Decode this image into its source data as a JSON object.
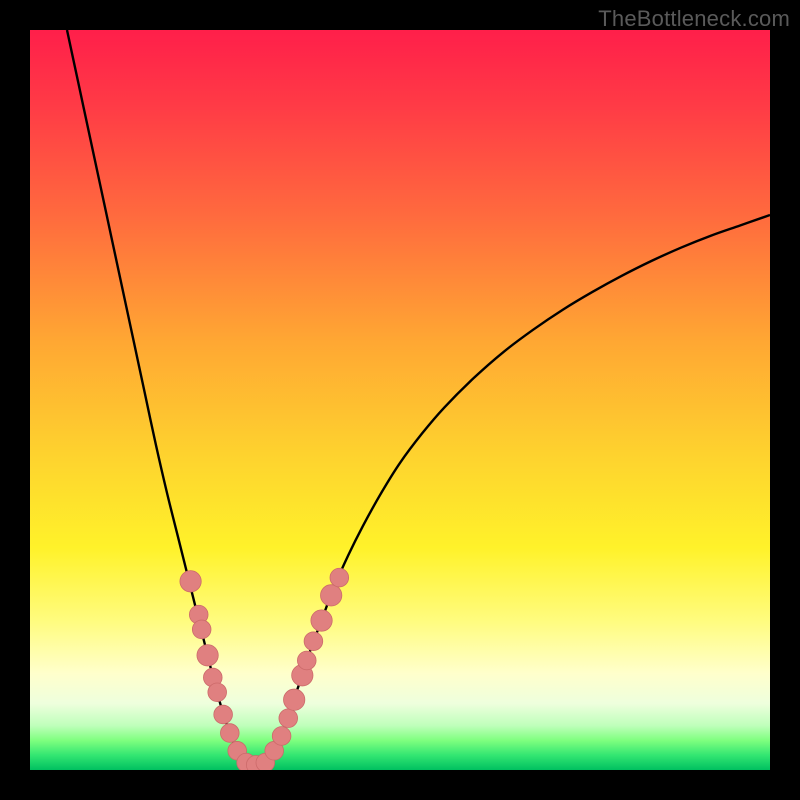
{
  "watermark": "TheBottleneck.com",
  "colors": {
    "curve": "#000000",
    "marker_fill": "#e08080",
    "marker_stroke": "#cc6a6a",
    "frame": "#000000"
  },
  "chart_data": {
    "type": "line",
    "title": "",
    "xlabel": "",
    "ylabel": "",
    "xlim": [
      0,
      100
    ],
    "ylim": [
      0,
      100
    ],
    "grid": false,
    "legend": false,
    "curve": {
      "points": [
        {
          "x": 5.0,
          "y": 100.0
        },
        {
          "x": 6.5,
          "y": 93.0
        },
        {
          "x": 8.0,
          "y": 86.0
        },
        {
          "x": 9.5,
          "y": 79.0
        },
        {
          "x": 11.0,
          "y": 72.0
        },
        {
          "x": 12.5,
          "y": 65.0
        },
        {
          "x": 14.0,
          "y": 58.0
        },
        {
          "x": 15.5,
          "y": 51.0
        },
        {
          "x": 17.0,
          "y": 44.0
        },
        {
          "x": 18.5,
          "y": 37.5
        },
        {
          "x": 20.0,
          "y": 31.5
        },
        {
          "x": 21.0,
          "y": 27.5
        },
        {
          "x": 22.0,
          "y": 23.5
        },
        {
          "x": 23.0,
          "y": 19.5
        },
        {
          "x": 24.0,
          "y": 15.5
        },
        {
          "x": 25.0,
          "y": 11.5
        },
        {
          "x": 26.0,
          "y": 8.0
        },
        {
          "x": 27.0,
          "y": 5.0
        },
        {
          "x": 28.0,
          "y": 2.6
        },
        {
          "x": 29.0,
          "y": 1.2
        },
        {
          "x": 30.0,
          "y": 0.7
        },
        {
          "x": 31.0,
          "y": 0.7
        },
        {
          "x": 32.0,
          "y": 1.2
        },
        {
          "x": 33.0,
          "y": 2.6
        },
        {
          "x": 34.0,
          "y": 4.6
        },
        {
          "x": 35.0,
          "y": 7.5
        },
        {
          "x": 36.0,
          "y": 10.5
        },
        {
          "x": 37.0,
          "y": 13.5
        },
        {
          "x": 38.0,
          "y": 16.5
        },
        {
          "x": 39.5,
          "y": 20.5
        },
        {
          "x": 41.0,
          "y": 24.5
        },
        {
          "x": 43.0,
          "y": 29.0
        },
        {
          "x": 45.0,
          "y": 33.0
        },
        {
          "x": 47.5,
          "y": 37.5
        },
        {
          "x": 50.0,
          "y": 41.5
        },
        {
          "x": 53.0,
          "y": 45.5
        },
        {
          "x": 56.0,
          "y": 49.0
        },
        {
          "x": 60.0,
          "y": 53.0
        },
        {
          "x": 64.0,
          "y": 56.5
        },
        {
          "x": 68.0,
          "y": 59.5
        },
        {
          "x": 72.0,
          "y": 62.2
        },
        {
          "x": 76.0,
          "y": 64.6
        },
        {
          "x": 80.0,
          "y": 66.8
        },
        {
          "x": 84.0,
          "y": 68.8
        },
        {
          "x": 88.0,
          "y": 70.6
        },
        {
          "x": 92.0,
          "y": 72.2
        },
        {
          "x": 96.0,
          "y": 73.6
        },
        {
          "x": 100.0,
          "y": 75.0
        }
      ]
    },
    "markers": [
      {
        "x": 21.7,
        "y": 25.5,
        "r": 1.6
      },
      {
        "x": 22.8,
        "y": 21.0,
        "r": 1.4
      },
      {
        "x": 23.2,
        "y": 19.0,
        "r": 1.4
      },
      {
        "x": 24.0,
        "y": 15.5,
        "r": 1.6
      },
      {
        "x": 24.7,
        "y": 12.5,
        "r": 1.4
      },
      {
        "x": 25.3,
        "y": 10.5,
        "r": 1.4
      },
      {
        "x": 26.1,
        "y": 7.5,
        "r": 1.4
      },
      {
        "x": 27.0,
        "y": 5.0,
        "r": 1.4
      },
      {
        "x": 28.0,
        "y": 2.6,
        "r": 1.4
      },
      {
        "x": 29.2,
        "y": 1.0,
        "r": 1.4
      },
      {
        "x": 30.5,
        "y": 0.7,
        "r": 1.4
      },
      {
        "x": 31.8,
        "y": 1.0,
        "r": 1.4
      },
      {
        "x": 33.0,
        "y": 2.6,
        "r": 1.4
      },
      {
        "x": 34.0,
        "y": 4.6,
        "r": 1.4
      },
      {
        "x": 34.9,
        "y": 7.0,
        "r": 1.4
      },
      {
        "x": 35.7,
        "y": 9.5,
        "r": 1.6
      },
      {
        "x": 36.8,
        "y": 12.8,
        "r": 1.6
      },
      {
        "x": 37.4,
        "y": 14.8,
        "r": 1.4
      },
      {
        "x": 38.3,
        "y": 17.4,
        "r": 1.4
      },
      {
        "x": 39.4,
        "y": 20.2,
        "r": 1.6
      },
      {
        "x": 40.7,
        "y": 23.6,
        "r": 1.6
      },
      {
        "x": 41.8,
        "y": 26.0,
        "r": 1.4
      }
    ]
  }
}
